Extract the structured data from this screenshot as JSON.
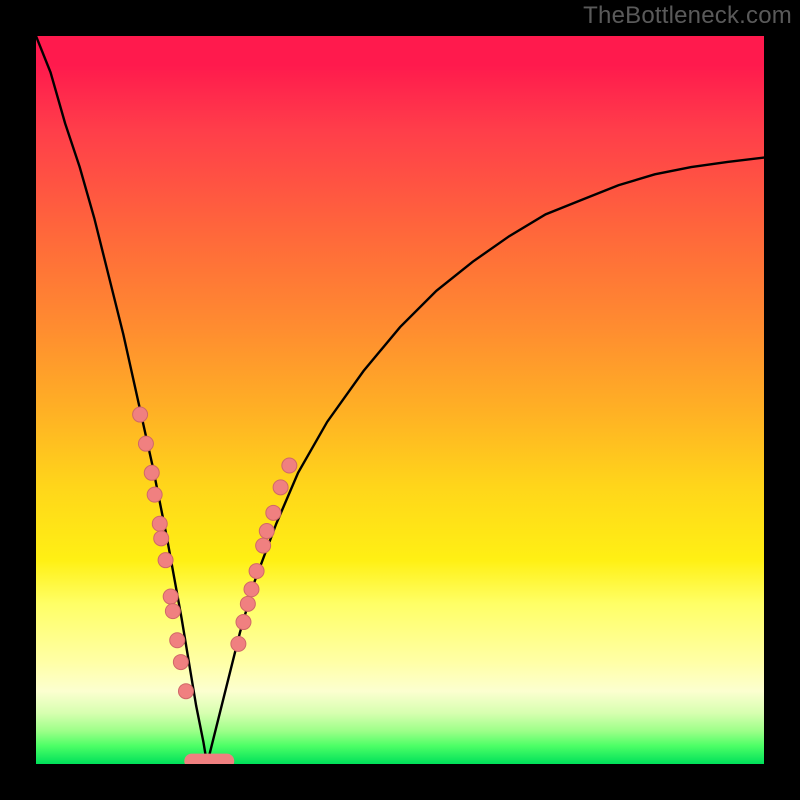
{
  "watermark": "TheBottleneck.com",
  "chart_data": {
    "type": "line",
    "title": "",
    "xlabel": "",
    "ylabel": "",
    "xlim": [
      0,
      100
    ],
    "ylim": [
      0,
      100
    ],
    "x_min_point": 23.5,
    "curve": {
      "x": [
        0,
        2,
        4,
        6,
        8,
        10,
        12,
        14,
        16,
        18,
        20,
        21,
        22,
        23,
        23.5,
        24,
        25,
        26,
        28,
        30,
        33,
        36,
        40,
        45,
        50,
        55,
        60,
        65,
        70,
        75,
        80,
        85,
        90,
        95,
        100
      ],
      "y": [
        100,
        95,
        88,
        82,
        75,
        67,
        59,
        50,
        41,
        31,
        20,
        14,
        8,
        3,
        0,
        2,
        6,
        10,
        18,
        25,
        33,
        40,
        47,
        54,
        60,
        65,
        69,
        72.5,
        75.5,
        77.5,
        79.5,
        81,
        82,
        82.7,
        83.3
      ]
    },
    "dots_left": {
      "x": [
        14.3,
        15.1,
        15.9,
        16.3,
        17.0,
        17.2,
        17.8,
        18.5,
        18.8,
        19.4,
        19.9,
        20.6
      ],
      "y": [
        48,
        44,
        40,
        37,
        33,
        31,
        28,
        23,
        21,
        17,
        14,
        10
      ]
    },
    "dots_right": {
      "x": [
        27.8,
        28.5,
        29.1,
        29.6,
        30.3,
        31.2,
        31.7,
        32.6,
        33.6,
        34.8
      ],
      "y": [
        16.5,
        19.5,
        22,
        24,
        26.5,
        30,
        32,
        34.5,
        38,
        41
      ]
    },
    "bottom_segment": {
      "x": [
        21.4,
        22.0,
        22.6,
        23.2,
        23.8,
        24.4,
        25.0,
        25.6,
        26.2
      ],
      "y": [
        0.4,
        0.4,
        0.4,
        0.4,
        0.4,
        0.4,
        0.4,
        0.4,
        0.4
      ]
    },
    "colors": {
      "line": "#000000",
      "dot_fill": "#f08080",
      "dot_stroke": "#d06868",
      "gradient_top": "#ff1a4d",
      "gradient_bottom": "#00e05a"
    }
  }
}
